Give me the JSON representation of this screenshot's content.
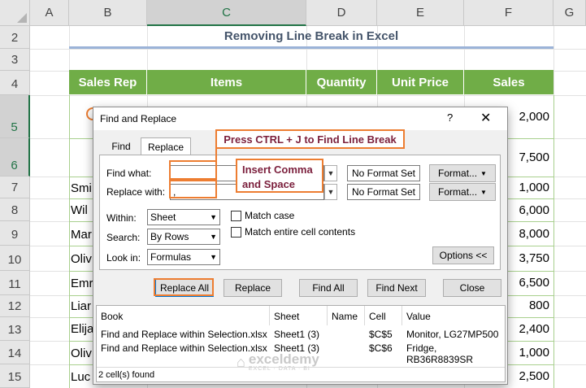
{
  "columns": [
    "A",
    "B",
    "C",
    "D",
    "E",
    "F",
    "G"
  ],
  "rows": [
    "2",
    "3",
    "4",
    "5",
    "6",
    "7",
    "8",
    "9",
    "10",
    "11",
    "12",
    "13",
    "14",
    "15"
  ],
  "sheet": {
    "title": "Removing Line Break in Excel",
    "headers": [
      "Sales Rep",
      "Items",
      "Quantity",
      "Unit Price",
      "Sales"
    ],
    "reps_visible": [
      "Smi",
      "Wil",
      "Mar",
      "Oliv",
      "Emr",
      "Liar",
      "Elija",
      "Oliv",
      "Luc"
    ],
    "sales": [
      "2,000",
      "7,500",
      "1,000",
      "6,000",
      "8,000",
      "3,750",
      "6,500",
      "800",
      "2,400",
      "1,000",
      "2,500"
    ]
  },
  "dialog": {
    "title": "Find and Replace",
    "help": "?",
    "close": "✕",
    "tabs": [
      "Find",
      "Replace"
    ],
    "find_what_label": "Find what:",
    "find_what_value": "",
    "replace_with_label": "Replace with:",
    "replace_with_value": ",",
    "no_format_set": "No Format Set",
    "format_btn": "Format...",
    "within_label": "Within:",
    "within_value": "Sheet",
    "search_label": "Search:",
    "search_value": "By Rows",
    "lookin_label": "Look in:",
    "lookin_value": "Formulas",
    "match_case": "Match case",
    "match_entire": "Match entire cell contents",
    "options_btn": "Options <<",
    "buttons": {
      "replace_all": "Replace All",
      "replace": "Replace",
      "find_all": "Find All",
      "find_next": "Find Next",
      "close": "Close"
    },
    "results": {
      "headers": [
        "Book",
        "Sheet",
        "Name",
        "Cell",
        "Value"
      ],
      "rows": [
        [
          "Find and Replace within Selection.xlsx",
          "Sheet1 (3)",
          "",
          "$C$5",
          "Monitor, LG27MP500"
        ],
        [
          "Find and Replace within Selection.xlsx",
          "Sheet1 (3)",
          "",
          "$C$6",
          "Fridge, RB36R8839SR"
        ]
      ],
      "status": "2 cell(s) found"
    }
  },
  "annotations": {
    "callout1": "Press CTRL + J to Find Line Break",
    "callout2_a": "Insert Comma",
    "callout2_b": "and Space"
  },
  "watermark": {
    "name": "exceldemy",
    "tagline": "EXCEL · DATA · BI"
  },
  "colors": {
    "header_green": "#70ad47",
    "accent_orange": "#ed7d31",
    "callout_text": "#7b1f3c"
  }
}
